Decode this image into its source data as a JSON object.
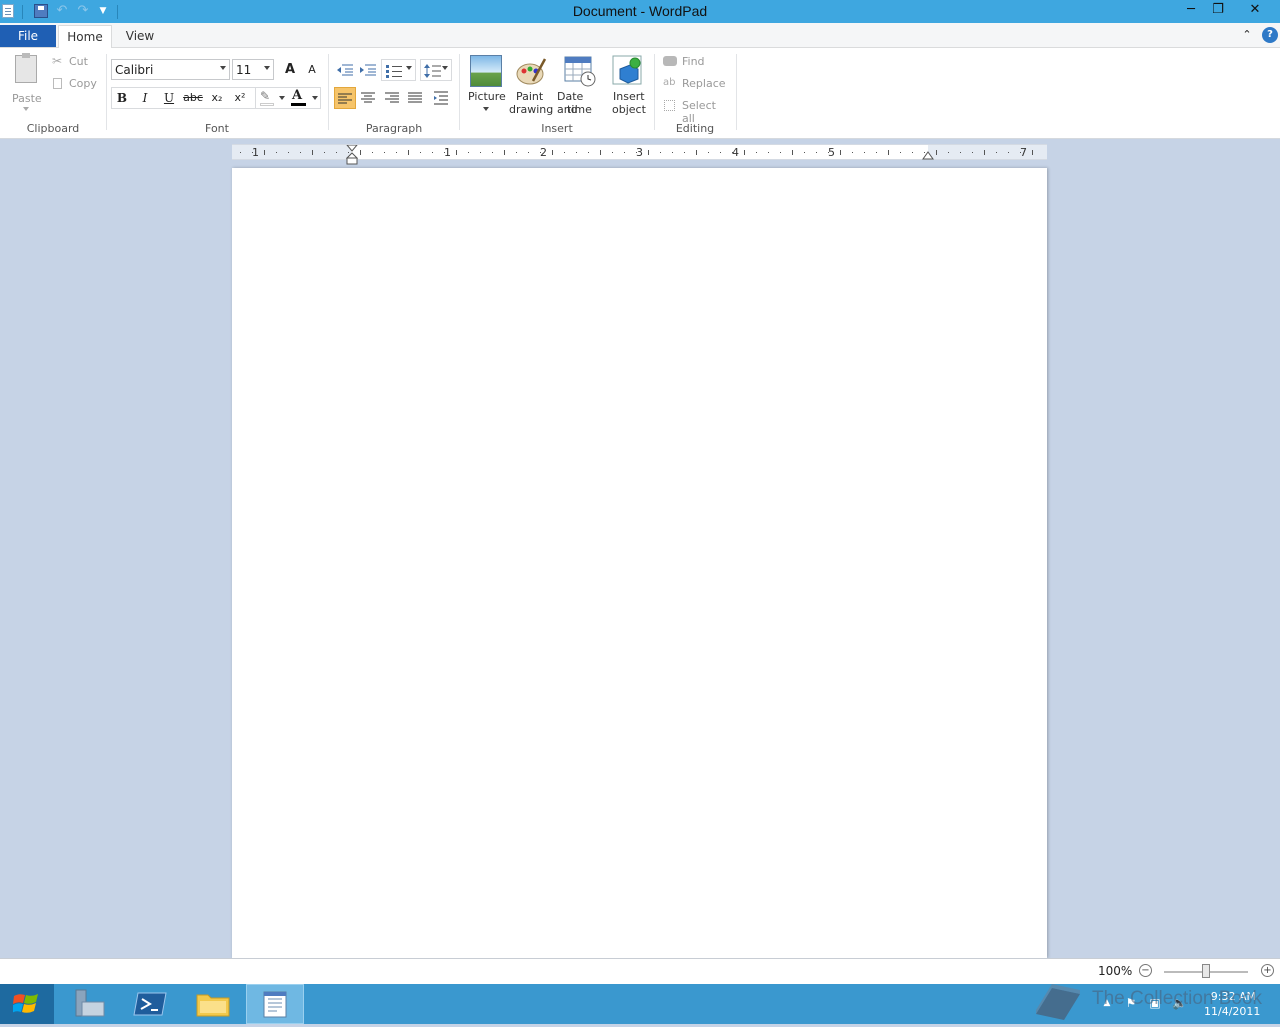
{
  "window": {
    "title": "Document - WordPad",
    "minimize_icon": "minimize-icon",
    "maximize_icon": "restore-icon",
    "close_icon": "close-icon"
  },
  "quick_access": {
    "save_icon": "save-icon",
    "undo_icon": "undo-icon",
    "redo_icon": "redo-icon",
    "customize_icon": "chevron-down-icon"
  },
  "tabs": [
    {
      "label": "File"
    },
    {
      "label": "Home",
      "active": true
    },
    {
      "label": "View"
    }
  ],
  "ribbon": {
    "clipboard": {
      "label": "Clipboard",
      "paste": "Paste",
      "cut": "Cut",
      "copy": "Copy"
    },
    "font": {
      "label": "Font",
      "family": "Calibri",
      "size": "11",
      "grow_glyph": "A",
      "shrink_glyph": "A",
      "bold": "B",
      "italic": "I",
      "underline": "U",
      "strike": "abc",
      "subscript": "x₂",
      "superscript": "x²",
      "color_glyph": "A"
    },
    "paragraph": {
      "label": "Paragraph"
    },
    "insert": {
      "label": "Insert",
      "picture": "Picture",
      "paint_line1": "Paint",
      "paint_line2": "drawing",
      "date_line1": "Date and",
      "date_line2": "time",
      "object_line1": "Insert",
      "object_line2": "object"
    },
    "editing": {
      "label": "Editing",
      "find": "Find",
      "replace": "Replace",
      "select_all": "Select all"
    }
  },
  "ruler": {
    "numbers": [
      "1",
      "1",
      "2",
      "3",
      "4",
      "5",
      "7"
    ]
  },
  "status": {
    "zoom": "100%",
    "zoom_out": "−",
    "zoom_in": "+",
    "zoom_level": 0.5
  },
  "taskbar": {
    "time": "9:32 AM",
    "date": "11/4/2011",
    "watermark": "The Collection Book"
  },
  "colors": {
    "title_bar": "#3ea7e0",
    "file_tab": "#1f5fb4",
    "taskbar": "#3a98cf",
    "selection": "#f6c46a"
  }
}
